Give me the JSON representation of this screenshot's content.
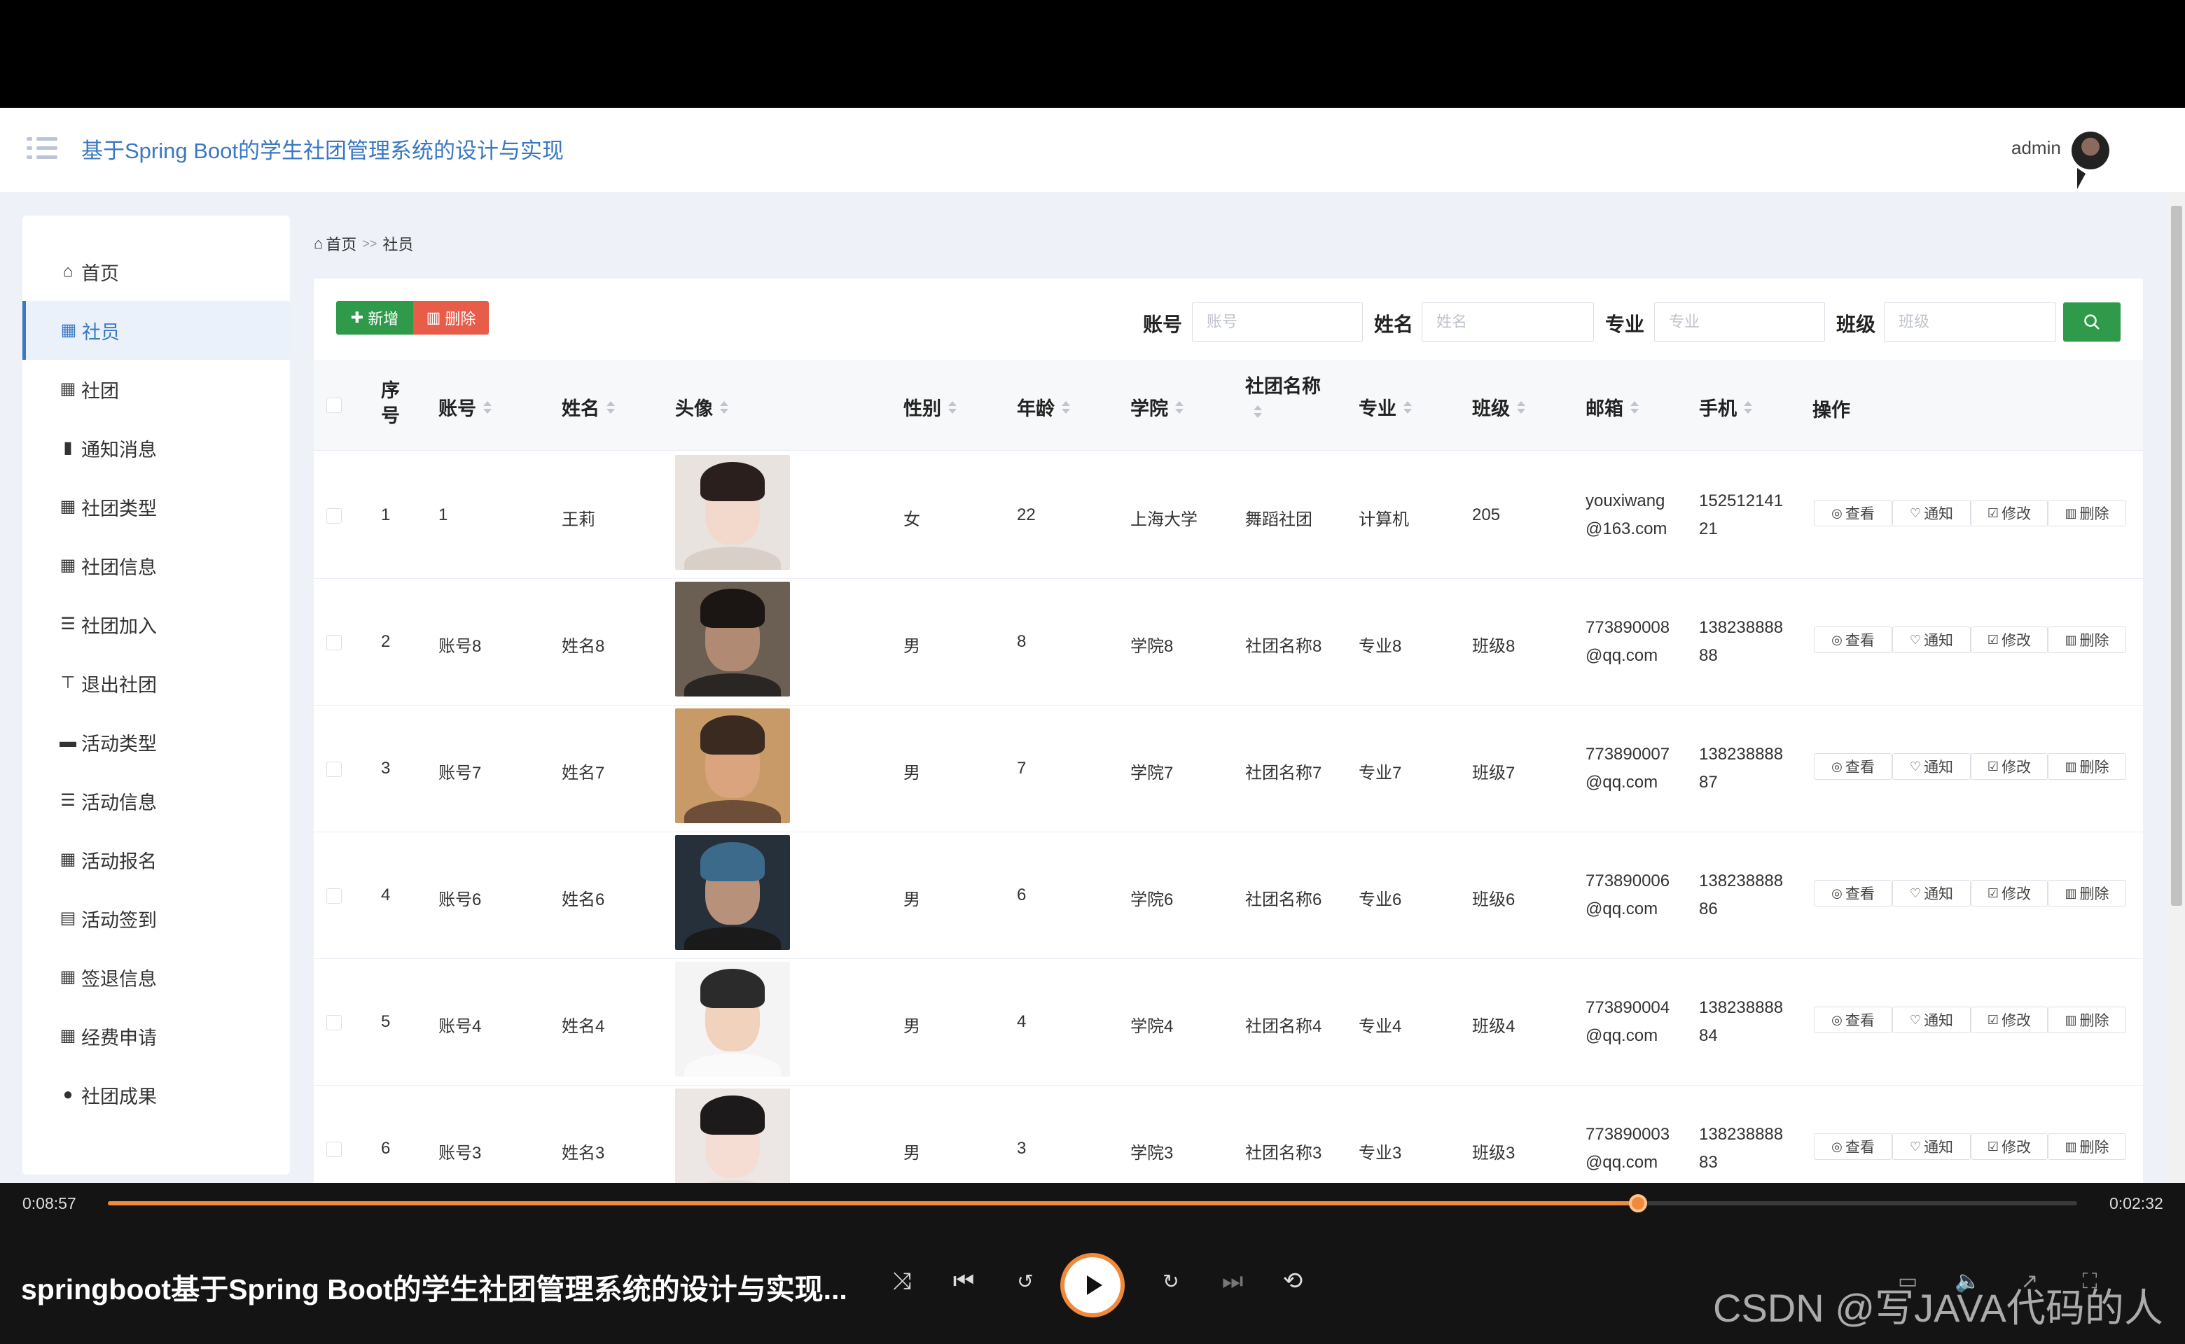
{
  "app": {
    "title": "基于Spring Boot的学生社团管理系统的设计与实现",
    "user": "admin"
  },
  "sidebar": {
    "items": [
      {
        "label": "首页",
        "icon": "home-icon",
        "glyph": "⌂"
      },
      {
        "label": "社员",
        "icon": "grid-icon",
        "glyph": "▦"
      },
      {
        "label": "社团",
        "icon": "grid-icon",
        "glyph": "▦"
      },
      {
        "label": "通知消息",
        "icon": "book-icon",
        "glyph": "▮"
      },
      {
        "label": "社团类型",
        "icon": "grid-icon",
        "glyph": "▦"
      },
      {
        "label": "社团信息",
        "icon": "grid-icon",
        "glyph": "▦"
      },
      {
        "label": "社团加入",
        "icon": "list-icon",
        "glyph": "☰"
      },
      {
        "label": "退出社团",
        "icon": "sign-icon",
        "glyph": "⊤"
      },
      {
        "label": "活动类型",
        "icon": "monitor-icon",
        "glyph": "▬"
      },
      {
        "label": "活动信息",
        "icon": "list-icon",
        "glyph": "☰"
      },
      {
        "label": "活动报名",
        "icon": "grid-icon",
        "glyph": "▦"
      },
      {
        "label": "活动签到",
        "icon": "clipboard-icon",
        "glyph": "▤"
      },
      {
        "label": "签退信息",
        "icon": "grid-icon",
        "glyph": "▦"
      },
      {
        "label": "经费申请",
        "icon": "grid-icon",
        "glyph": "▦"
      },
      {
        "label": "社团成果",
        "icon": "user-icon",
        "glyph": "●"
      }
    ]
  },
  "breadcrumb": {
    "home": "首页",
    "sep": ">>",
    "current": "社员"
  },
  "toolbar": {
    "add_label": "新增",
    "delete_label": "删除"
  },
  "filters": {
    "account_label": "账号",
    "account_placeholder": "账号",
    "name_label": "姓名",
    "name_placeholder": "姓名",
    "major_label": "专业",
    "major_placeholder": "专业",
    "class_label": "班级",
    "class_placeholder": "班级"
  },
  "table": {
    "columns": {
      "index_line1": "序",
      "index_line2": "号",
      "account": "账号",
      "name": "姓名",
      "avatar": "头像",
      "gender": "性别",
      "age": "年龄",
      "college": "学院",
      "club": "社团名称",
      "major": "专业",
      "class": "班级",
      "email": "邮箱",
      "phone": "手机",
      "ops": "操作"
    },
    "rows": [
      {
        "idx": "1",
        "account": "1",
        "name": "王莉",
        "gender": "女",
        "age": "22",
        "college": "上海大学",
        "club": "舞蹈社团",
        "major": "计算机",
        "class": "205",
        "email1": "youxiwang",
        "email2": "@163.com",
        "phone1": "152512141",
        "phone2": "21"
      },
      {
        "idx": "2",
        "account": "账号8",
        "name": "姓名8",
        "gender": "男",
        "age": "8",
        "college": "学院8",
        "club": "社团名称8",
        "major": "专业8",
        "class": "班级8",
        "email1": "773890008",
        "email2": "@qq.com",
        "phone1": "138238888",
        "phone2": "88"
      },
      {
        "idx": "3",
        "account": "账号7",
        "name": "姓名7",
        "gender": "男",
        "age": "7",
        "college": "学院7",
        "club": "社团名称7",
        "major": "专业7",
        "class": "班级7",
        "email1": "773890007",
        "email2": "@qq.com",
        "phone1": "138238888",
        "phone2": "87"
      },
      {
        "idx": "4",
        "account": "账号6",
        "name": "姓名6",
        "gender": "男",
        "age": "6",
        "college": "学院6",
        "club": "社团名称6",
        "major": "专业6",
        "class": "班级6",
        "email1": "773890006",
        "email2": "@qq.com",
        "phone1": "138238888",
        "phone2": "86"
      },
      {
        "idx": "5",
        "account": "账号4",
        "name": "姓名4",
        "gender": "男",
        "age": "4",
        "college": "学院4",
        "club": "社团名称4",
        "major": "专业4",
        "class": "班级4",
        "email1": "773890004",
        "email2": "@qq.com",
        "phone1": "138238888",
        "phone2": "84"
      },
      {
        "idx": "6",
        "account": "账号3",
        "name": "姓名3",
        "gender": "男",
        "age": "3",
        "college": "学院3",
        "club": "社团名称3",
        "major": "专业3",
        "class": "班级3",
        "email1": "773890003",
        "email2": "@qq.com",
        "phone1": "138238888",
        "phone2": "83"
      }
    ],
    "actions": {
      "view": "查看",
      "notify": "通知",
      "edit": "修改",
      "delete": "删除"
    }
  },
  "player": {
    "current_time": "0:08:57",
    "total_time": "0:02:32",
    "progress": 0.777,
    "title": "springboot基于Spring Boot的学生社团管理系统的设计与实现...",
    "watermark": "CSDN @写JAVA代码的人",
    "accent": "#f08a3a"
  },
  "colors": {
    "primary": "#3a78c3",
    "success": "#2e9a4a",
    "danger": "#e85c4a"
  }
}
